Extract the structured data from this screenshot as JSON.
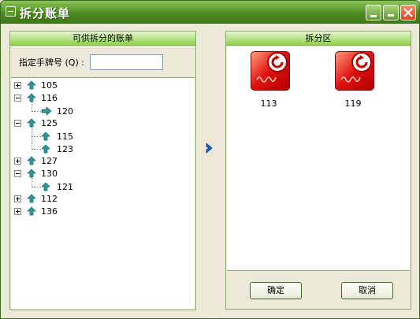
{
  "window": {
    "title": "拆分账单"
  },
  "left_panel": {
    "header": "可供拆分的账单",
    "search": {
      "label": "指定手牌号 (Q) :",
      "value": ""
    },
    "tree": [
      {
        "label": "105",
        "expander": "plus",
        "children": []
      },
      {
        "label": "116",
        "expander": "minus",
        "children": [
          {
            "label": "120",
            "icon": "arrow-right-icon"
          }
        ]
      },
      {
        "label": "125",
        "expander": "minus",
        "children": [
          {
            "label": "115",
            "icon": "arrow-up-icon"
          },
          {
            "label": "123",
            "icon": "arrow-up-icon"
          }
        ]
      },
      {
        "label": "127",
        "expander": "plus",
        "children": []
      },
      {
        "label": "130",
        "expander": "minus",
        "children": [
          {
            "label": "121",
            "icon": "arrow-up-icon"
          }
        ]
      },
      {
        "label": "112",
        "expander": "plus",
        "children": []
      },
      {
        "label": "136",
        "expander": "plus",
        "children": []
      }
    ]
  },
  "right_panel": {
    "header": "拆分区",
    "items": [
      {
        "label": "113"
      },
      {
        "label": "119"
      }
    ],
    "ok_label": "确定",
    "cancel_label": "取消"
  },
  "colors": {
    "title_bar": "#5b9a2b",
    "panel_header": "#b6e38a",
    "node_icon": "#2a8a8a",
    "bill_icon": "#e01010"
  }
}
